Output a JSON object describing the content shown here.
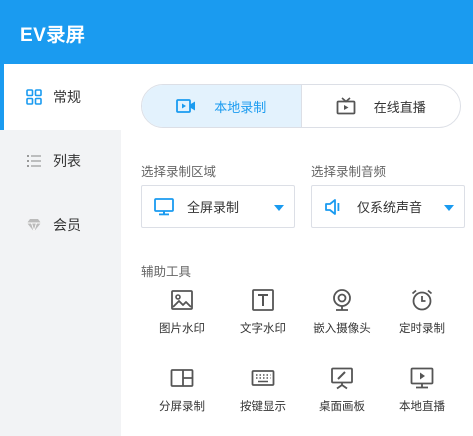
{
  "app": {
    "title": "EV录屏"
  },
  "sidebar": {
    "items": [
      {
        "label": "常规",
        "icon": "grid-icon",
        "active": true
      },
      {
        "label": "列表",
        "icon": "list-icon",
        "active": false
      },
      {
        "label": "会员",
        "icon": "diamond-icon",
        "active": false
      }
    ]
  },
  "mode_tabs": [
    {
      "label": "本地录制",
      "icon": "video-camera-icon",
      "active": true
    },
    {
      "label": "在线直播",
      "icon": "tv-icon",
      "active": false
    }
  ],
  "record_area": {
    "label": "选择录制区域",
    "value": "全屏录制",
    "icon": "monitor-icon"
  },
  "record_audio": {
    "label": "选择录制音频",
    "value": "仅系统声音",
    "icon": "speaker-icon"
  },
  "tools": {
    "label": "辅助工具",
    "items": [
      {
        "label": "图片水印",
        "icon": "image-icon"
      },
      {
        "label": "文字水印",
        "icon": "text-icon"
      },
      {
        "label": "嵌入摄像头",
        "icon": "webcam-icon"
      },
      {
        "label": "定时录制",
        "icon": "alarm-clock-icon"
      },
      {
        "label": "分屏录制",
        "icon": "split-screen-icon"
      },
      {
        "label": "按键显示",
        "icon": "keyboard-icon"
      },
      {
        "label": "桌面画板",
        "icon": "easel-icon"
      },
      {
        "label": "本地直播",
        "icon": "play-monitor-icon"
      }
    ]
  },
  "colors": {
    "accent": "#1a9bf0",
    "sidebar_bg": "#f2f3f5",
    "active_tab_bg": "#e3f2fd",
    "icon_gray": "#555555"
  }
}
